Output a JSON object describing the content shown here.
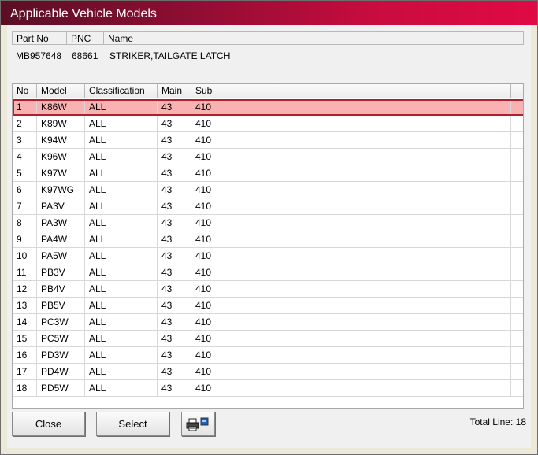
{
  "window": {
    "title": "Applicable Vehicle Models"
  },
  "part_info": {
    "headers": [
      "Part No",
      "PNC",
      "Name"
    ],
    "values": {
      "part_no": "MB957648",
      "pnc": "68661",
      "name": "STRIKER,TAILGATE LATCH"
    }
  },
  "table": {
    "headers": [
      "No",
      "Model",
      "Classification",
      "Main",
      "Sub"
    ],
    "selected_index": 0,
    "rows": [
      [
        "1",
        "K86W",
        "ALL",
        "43",
        "410"
      ],
      [
        "2",
        "K89W",
        "ALL",
        "43",
        "410"
      ],
      [
        "3",
        "K94W",
        "ALL",
        "43",
        "410"
      ],
      [
        "4",
        "K96W",
        "ALL",
        "43",
        "410"
      ],
      [
        "5",
        "K97W",
        "ALL",
        "43",
        "410"
      ],
      [
        "6",
        "K97WG",
        "ALL",
        "43",
        "410"
      ],
      [
        "7",
        "PA3V",
        "ALL",
        "43",
        "410"
      ],
      [
        "8",
        "PA3W",
        "ALL",
        "43",
        "410"
      ],
      [
        "9",
        "PA4W",
        "ALL",
        "43",
        "410"
      ],
      [
        "10",
        "PA5W",
        "ALL",
        "43",
        "410"
      ],
      [
        "11",
        "PB3V",
        "ALL",
        "43",
        "410"
      ],
      [
        "12",
        "PB4V",
        "ALL",
        "43",
        "410"
      ],
      [
        "13",
        "PB5V",
        "ALL",
        "43",
        "410"
      ],
      [
        "14",
        "PC3W",
        "ALL",
        "43",
        "410"
      ],
      [
        "15",
        "PC5W",
        "ALL",
        "43",
        "410"
      ],
      [
        "16",
        "PD3W",
        "ALL",
        "43",
        "410"
      ],
      [
        "17",
        "PD4W",
        "ALL",
        "43",
        "410"
      ],
      [
        "18",
        "PD5W",
        "ALL",
        "43",
        "410"
      ]
    ]
  },
  "buttons": {
    "close": "Close",
    "select": "Select",
    "print_icon": "printer-icon"
  },
  "status": {
    "total": "Total Line: 18"
  },
  "colors": {
    "title_start": "#5a0f24",
    "title_end": "#e00a44",
    "selected_row": "#f9b2b2",
    "selected_border": "#b11f2b"
  }
}
